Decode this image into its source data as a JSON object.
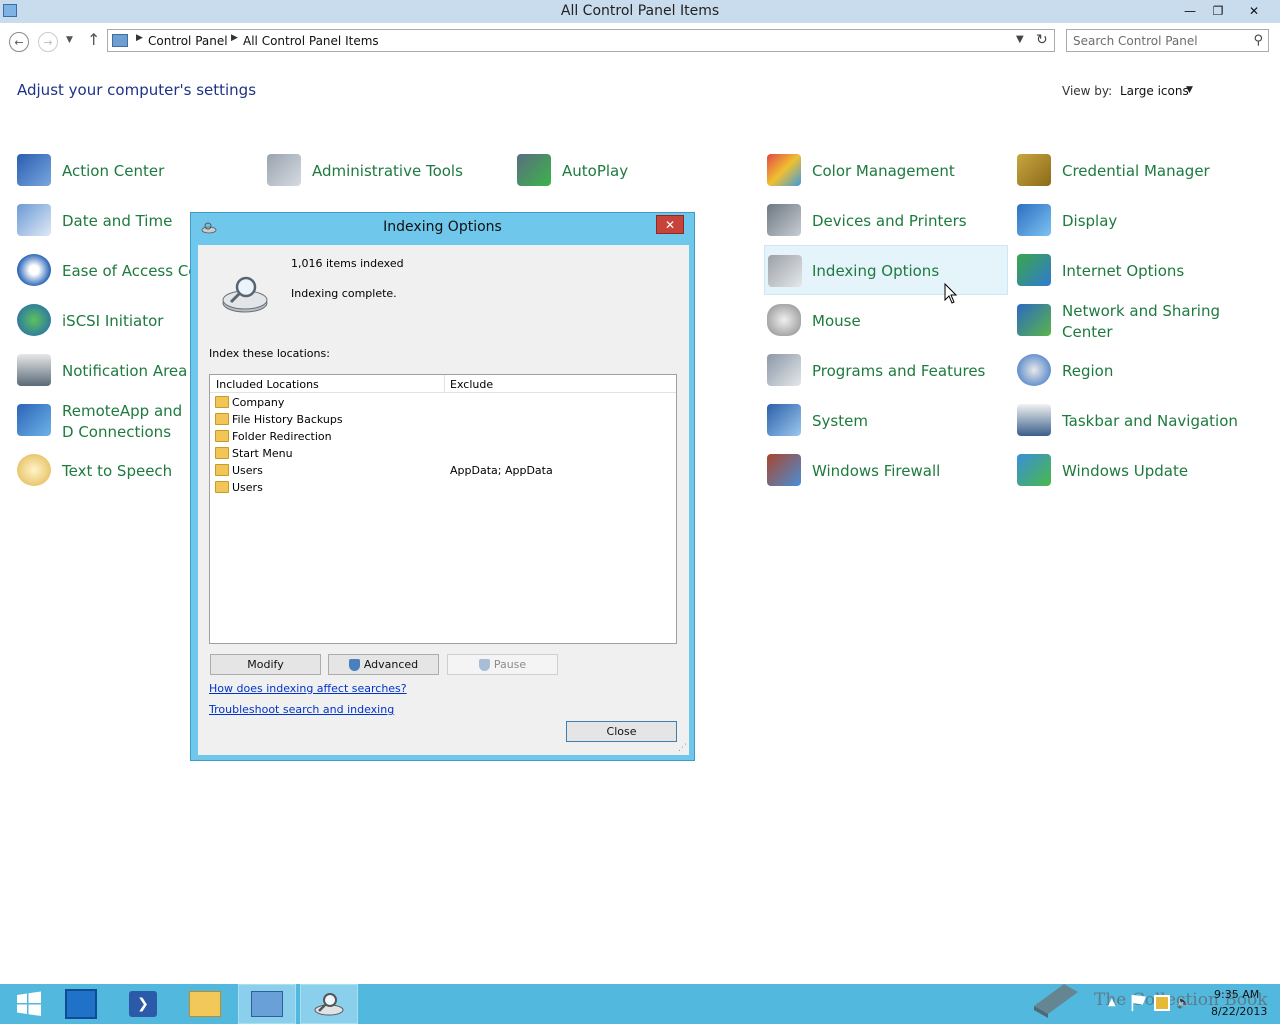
{
  "window": {
    "title": "All Control Panel Items",
    "minimize_glyph": "—",
    "maximize_glyph": "❐",
    "close_glyph": "✕"
  },
  "navigation": {
    "breadcrumb": [
      "Control Panel",
      "All Control Panel Items"
    ],
    "search_placeholder": "Search Control Panel"
  },
  "header": {
    "title": "Adjust your computer's settings",
    "view_by_label": "View by:",
    "view_by_value": "Large icons"
  },
  "items": [
    {
      "label": "Action Center",
      "icon": "flag-icon"
    },
    {
      "label": "Administrative Tools",
      "icon": "admin-tools-icon"
    },
    {
      "label": "AutoPlay",
      "icon": "autoplay-icon"
    },
    {
      "label": "Color Management",
      "icon": "color-management-icon"
    },
    {
      "label": "Credential Manager",
      "icon": "credential-vault-icon"
    },
    {
      "label": "Date and Time",
      "icon": "calendar-clock-icon"
    },
    {
      "label": "Devices and Printers",
      "icon": "printer-icon"
    },
    {
      "label": "Display",
      "icon": "monitor-icon"
    },
    {
      "label": "Ease of Access Cen",
      "icon": "ease-of-access-icon"
    },
    {
      "label": "Indexing Options",
      "icon": "indexing-icon"
    },
    {
      "label": "Internet Options",
      "icon": "globe-checklist-icon"
    },
    {
      "label": "iSCSI Initiator",
      "icon": "iscsi-globe-icon"
    },
    {
      "label": "Mouse",
      "icon": "mouse-icon"
    },
    {
      "label": "Network and Sharing Center",
      "icon": "network-icon"
    },
    {
      "label": "Notification Area Ic",
      "icon": "notification-area-icon"
    },
    {
      "label": "Programs and Features",
      "icon": "programs-icon"
    },
    {
      "label": "Region",
      "icon": "region-clock-icon"
    },
    {
      "label": "RemoteApp and D Connections",
      "icon": "remoteapp-icon"
    },
    {
      "label": "System",
      "icon": "system-icon"
    },
    {
      "label": "Taskbar and Navigation",
      "icon": "taskbar-icon"
    },
    {
      "label": "Text to Speech",
      "icon": "speech-bubble-icon"
    },
    {
      "label": "Windows Firewall",
      "icon": "firewall-icon"
    },
    {
      "label": "Windows Update",
      "icon": "windows-update-icon"
    }
  ],
  "dialog": {
    "title": "Indexing Options",
    "items_indexed": "1,016 items indexed",
    "status": "Indexing complete.",
    "index_label": "Index these locations:",
    "columns": [
      "Included Locations",
      "Exclude"
    ],
    "locations": [
      {
        "name": "Company",
        "exclude": ""
      },
      {
        "name": "File History Backups",
        "exclude": ""
      },
      {
        "name": "Folder Redirection",
        "exclude": ""
      },
      {
        "name": "Start Menu",
        "exclude": ""
      },
      {
        "name": "Users",
        "exclude": "AppData; AppData"
      },
      {
        "name": "Users",
        "exclude": ""
      }
    ],
    "buttons": {
      "modify": "Modify",
      "advanced": "Advanced",
      "pause": "Pause",
      "close": "Close"
    },
    "links": {
      "how": "How does indexing affect searches?",
      "troubleshoot": "Troubleshoot search and indexing"
    }
  },
  "taskbar": {
    "time": "9:35 AM",
    "date": "8/22/2013",
    "watermark": "The Collection Book"
  }
}
